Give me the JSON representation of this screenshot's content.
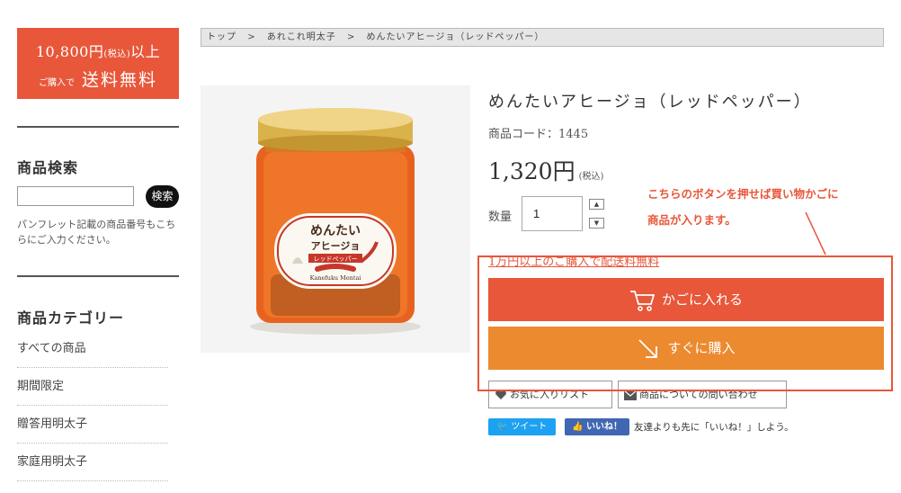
{
  "sidebar": {
    "promo": {
      "amount": "10,800円",
      "tax_note": "(税込)",
      "above": "以上",
      "purchase": "ご購入で",
      "free_shipping": "送料無料"
    },
    "search": {
      "heading": "商品検索",
      "input_value": "",
      "button_label": "検索",
      "note": "パンフレット記載の商品番号もこちらにご入力ください。"
    },
    "categories": {
      "heading": "商品カテゴリー",
      "items": [
        {
          "label": "すべての商品"
        },
        {
          "label": "期間限定"
        },
        {
          "label": "贈答用明太子"
        },
        {
          "label": "家庭用明太子"
        }
      ]
    }
  },
  "breadcrumb": [
    "トップ",
    ">",
    "あれこれ明太子",
    ">",
    "めんたいアヒージョ（レッドペッパー）"
  ],
  "product": {
    "title": "めんたいアヒージョ（レッドペッパー）",
    "code": "商品コード：1445",
    "price": "1,320円",
    "tax": "(税込)",
    "qty_label": "数量",
    "qty_value": "1",
    "shipping_link": "1万円以上のご購入で配送料無料",
    "image_label": {
      "line1": "めんたい",
      "line2": "アヒージョ",
      "line3": "レッドペッパー",
      "brand": "Kanefuku Mentai"
    }
  },
  "buttons": {
    "cart": "かごに入れる",
    "buy_now": "すぐに購入",
    "favorite": "お気に入りリスト",
    "inquiry": "商品についての問い合わせ"
  },
  "social": {
    "tweet": "ツイート",
    "like": "いいね！",
    "like_text": "友達よりも先に「いいね！」しよう。"
  },
  "annotation": {
    "line1": "こちらのボタンを押せば買い物かごに",
    "line2": "商品が入ります。"
  },
  "colors": {
    "accent": "#e8573a",
    "buy": "#ec8a2f",
    "twitter": "#1da1f2",
    "facebook": "#4267b2"
  }
}
